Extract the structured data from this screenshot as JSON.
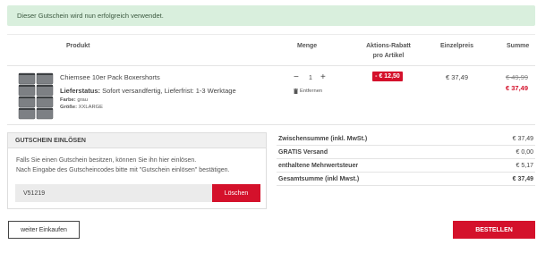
{
  "alert": {
    "message": "Dieser Gutschein wird nun erfolgreich verwendet."
  },
  "table": {
    "headers": {
      "product": "Produkt",
      "quantity": "Menge",
      "discount_line1": "Aktions-Rabatt",
      "discount_line2": "pro Artikel",
      "unit_price": "Einzelpreis",
      "total": "Summe"
    }
  },
  "item": {
    "name": "Chiemsee 10er Pack Boxershorts",
    "delivery_label": "Lieferstatus:",
    "delivery_value": "Sofort versandfertig, Lieferfrist: 1-3 Werktage",
    "color_label": "Farbe:",
    "color_value": "grau",
    "size_label": "Größe:",
    "size_value": "XXLARGE",
    "quantity": "1",
    "remove_label": "Entfernen",
    "discount": "- € 12,50",
    "unit_price": "€ 37,49",
    "old_price": "€ 49,99",
    "new_price": "€ 37,49",
    "image_icon": "boxershorts-stack"
  },
  "voucher": {
    "title": "GUTSCHEIN EINLÖSEN",
    "text_line1": "Falls Sie einen Gutschein besitzen, können Sie ihn hier einlösen.",
    "text_line2": "Nach Eingabe des Gutscheincodes bitte mit \"Gutschein einlösen\" bestätigen.",
    "code": "V51219",
    "delete_label": "Löschen"
  },
  "totals": [
    {
      "label": "Zwischensumme (inkl. MwSt.)",
      "value": "€ 37,49",
      "bold": false
    },
    {
      "label": "GRATIS Versand",
      "value": "€ 0,00",
      "bold": false
    },
    {
      "label": "enthaltene Mehrwertsteuer",
      "value": "€ 5,17",
      "bold": false
    },
    {
      "label": "Gesamtsumme (inkl Mwst.)",
      "value": "€ 37,49",
      "bold": true
    }
  ],
  "actions": {
    "continue_label": "weiter Einkaufen",
    "order_label": "BESTELLEN"
  },
  "colors": {
    "accent": "#d4112b",
    "success_bg": "#d9efdd"
  }
}
